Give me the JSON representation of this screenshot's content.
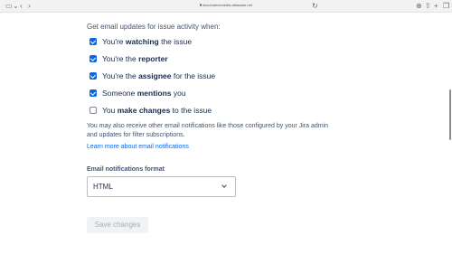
{
  "browser": {
    "url": "mizuhotechmedia.atlassian.net",
    "icons": [
      "sidebar-icon",
      "back-icon",
      "forward-icon",
      "shield-icon",
      "download-icon",
      "share-icon",
      "new-tab-icon",
      "tabs-icon"
    ]
  },
  "settings": {
    "heading": "Get email updates for issue activity when:",
    "options": [
      {
        "prefix": "You're ",
        "bold": "watching",
        "suffix": " the issue",
        "checked": true
      },
      {
        "prefix": "You're the ",
        "bold": "reporter",
        "suffix": "",
        "checked": true
      },
      {
        "prefix": "You're the ",
        "bold": "assignee",
        "suffix": " for the issue",
        "checked": true
      },
      {
        "prefix": "Someone ",
        "bold": "mentions",
        "suffix": " you",
        "checked": true
      },
      {
        "prefix": "You ",
        "bold": "make changes",
        "suffix": " to the issue",
        "checked": false
      }
    ],
    "info": "You may also receive other email notifications like those configured by your Jira admin and updates for filter subscriptions.",
    "learn_more": "Learn more about email notifications",
    "format_label": "Email notifications format",
    "format_value": "HTML",
    "save_label": "Save changes"
  },
  "colors": {
    "accent": "#0c66e4",
    "text": "#172b4d",
    "muted": "#42526e"
  }
}
